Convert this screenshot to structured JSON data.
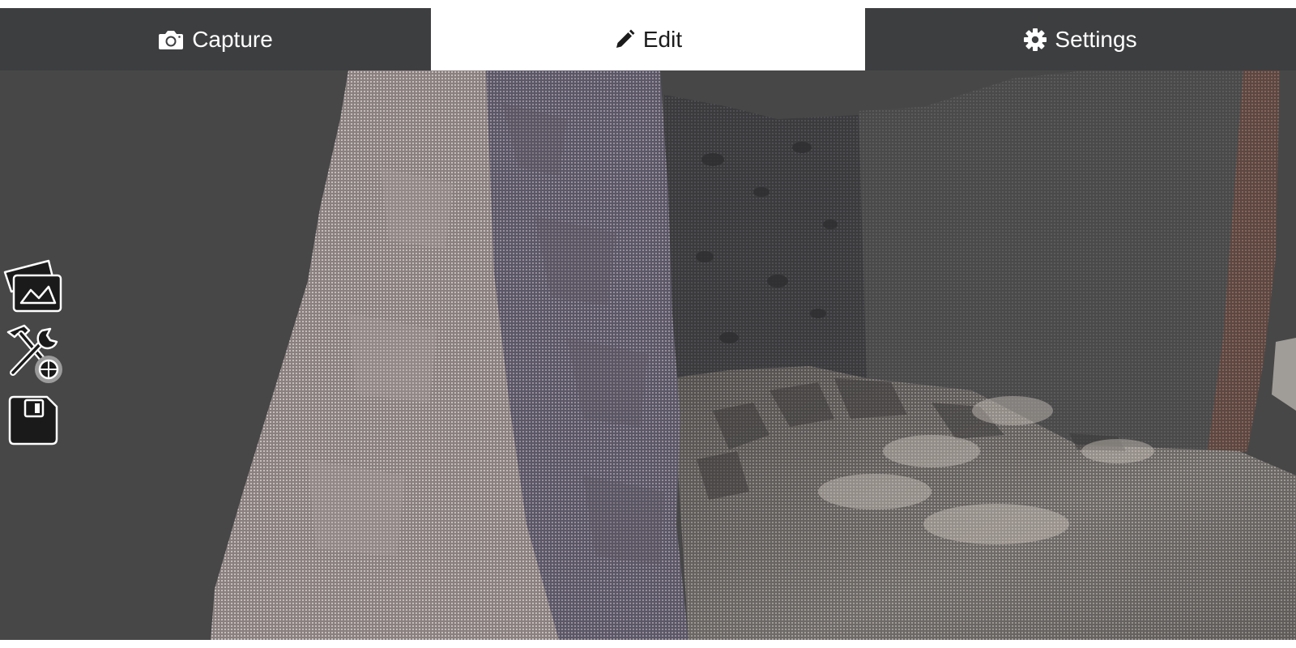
{
  "tabs": [
    {
      "label": "Capture",
      "icon": "camera-icon",
      "active": false
    },
    {
      "label": "Edit",
      "icon": "pencil-icon",
      "active": true
    },
    {
      "label": "Settings",
      "icon": "gear-icon",
      "active": false
    }
  ],
  "toolbar": {
    "items": [
      {
        "icon": "images-icon"
      },
      {
        "icon": "tools-icon"
      },
      {
        "icon": "save-icon"
      }
    ]
  },
  "colors": {
    "tab_inactive_bg": "#3d3e40",
    "tab_active_bg": "#ffffff",
    "viewport_bg": "#474747"
  }
}
